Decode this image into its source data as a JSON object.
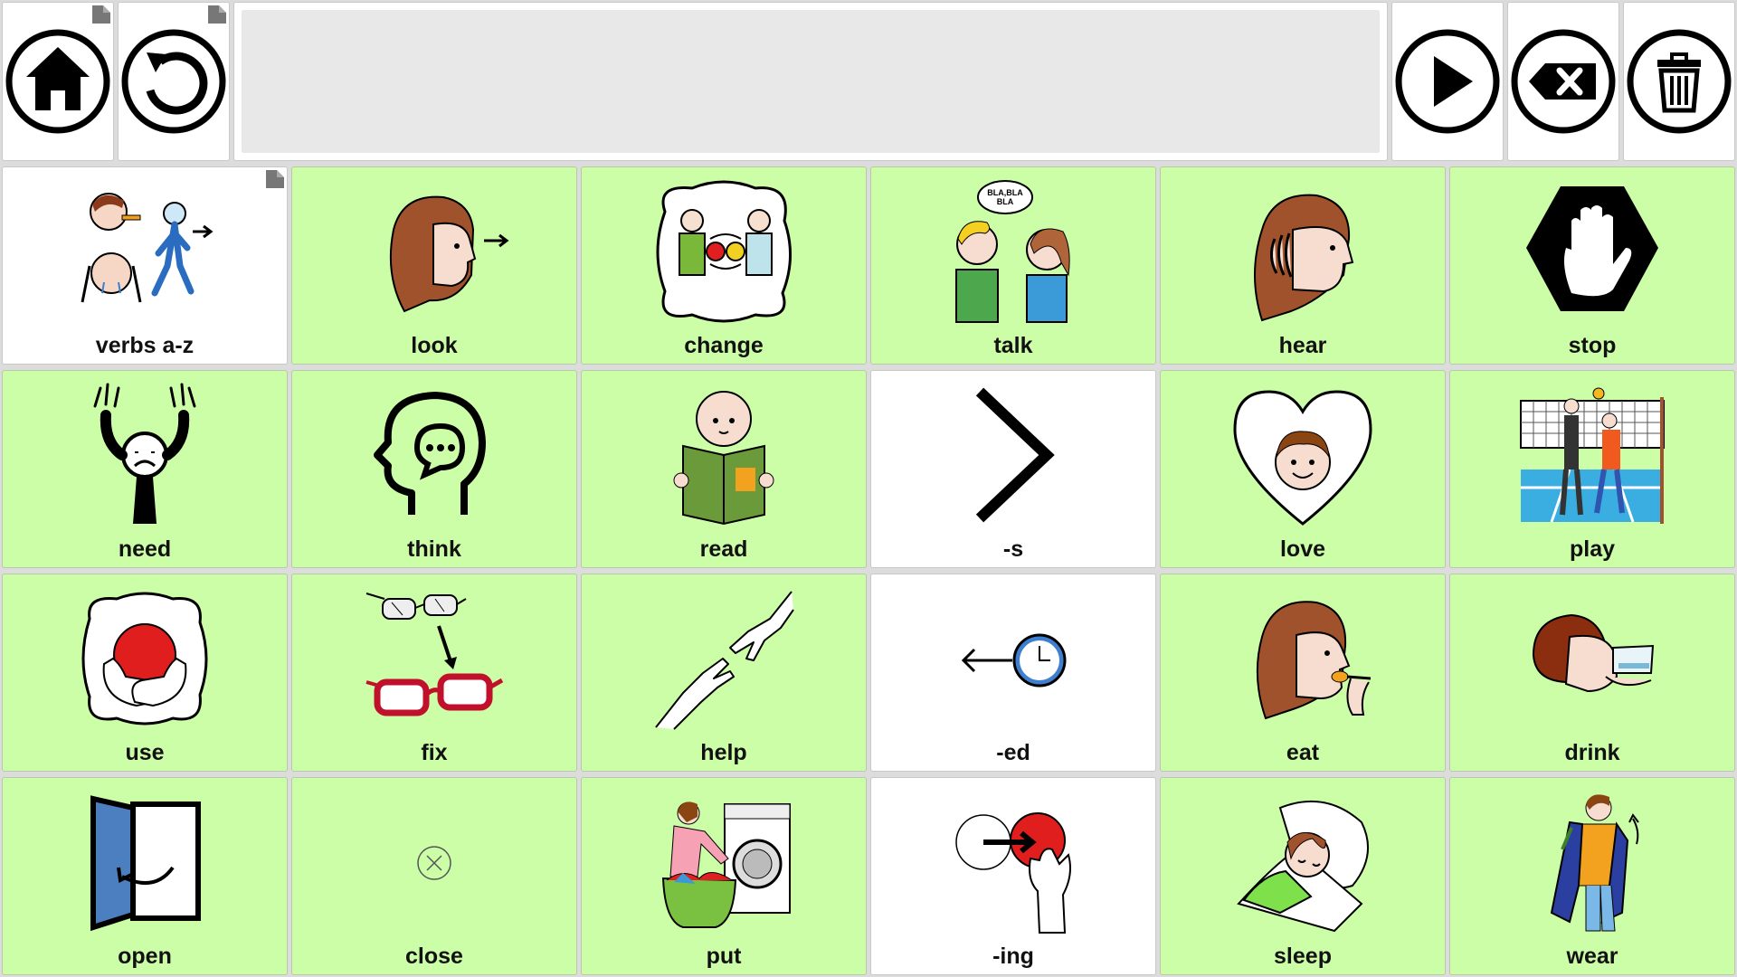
{
  "toolbar": {
    "home_icon": "home-icon",
    "back_icon": "undo-icon",
    "speak_icon": "play-icon",
    "backspace_icon": "backspace-icon",
    "clear_icon": "trash-icon",
    "message_text": ""
  },
  "colors": {
    "cell_green": "#ccfda7",
    "cell_white": "#ffffff",
    "message_bg": "#e8e8e8"
  },
  "cells": [
    {
      "label": "verbs a-z",
      "icon": "verbs-a-z-icon"
    },
    {
      "label": "look",
      "icon": "look-icon"
    },
    {
      "label": "change",
      "icon": "change-icon"
    },
    {
      "label": "talk",
      "icon": "talk-icon"
    },
    {
      "label": "hear",
      "icon": "hear-icon"
    },
    {
      "label": "stop",
      "icon": "stop-icon"
    },
    {
      "label": "need",
      "icon": "need-icon"
    },
    {
      "label": "think",
      "icon": "think-icon"
    },
    {
      "label": "read",
      "icon": "read-icon"
    },
    {
      "label": "-s",
      "icon": "suffix-s-icon"
    },
    {
      "label": "love",
      "icon": "love-icon"
    },
    {
      "label": "play",
      "icon": "play-sport-icon"
    },
    {
      "label": "use",
      "icon": "use-icon"
    },
    {
      "label": "fix",
      "icon": "fix-icon"
    },
    {
      "label": "help",
      "icon": "help-icon"
    },
    {
      "label": "-ed",
      "icon": "suffix-ed-icon"
    },
    {
      "label": "eat",
      "icon": "eat-icon"
    },
    {
      "label": "drink",
      "icon": "drink-icon"
    },
    {
      "label": "open",
      "icon": "open-icon"
    },
    {
      "label": "close",
      "icon": "close-placeholder-icon"
    },
    {
      "label": "put",
      "icon": "put-icon"
    },
    {
      "label": "-ing",
      "icon": "suffix-ing-icon"
    },
    {
      "label": "sleep",
      "icon": "sleep-icon"
    },
    {
      "label": "wear",
      "icon": "wear-icon"
    }
  ]
}
